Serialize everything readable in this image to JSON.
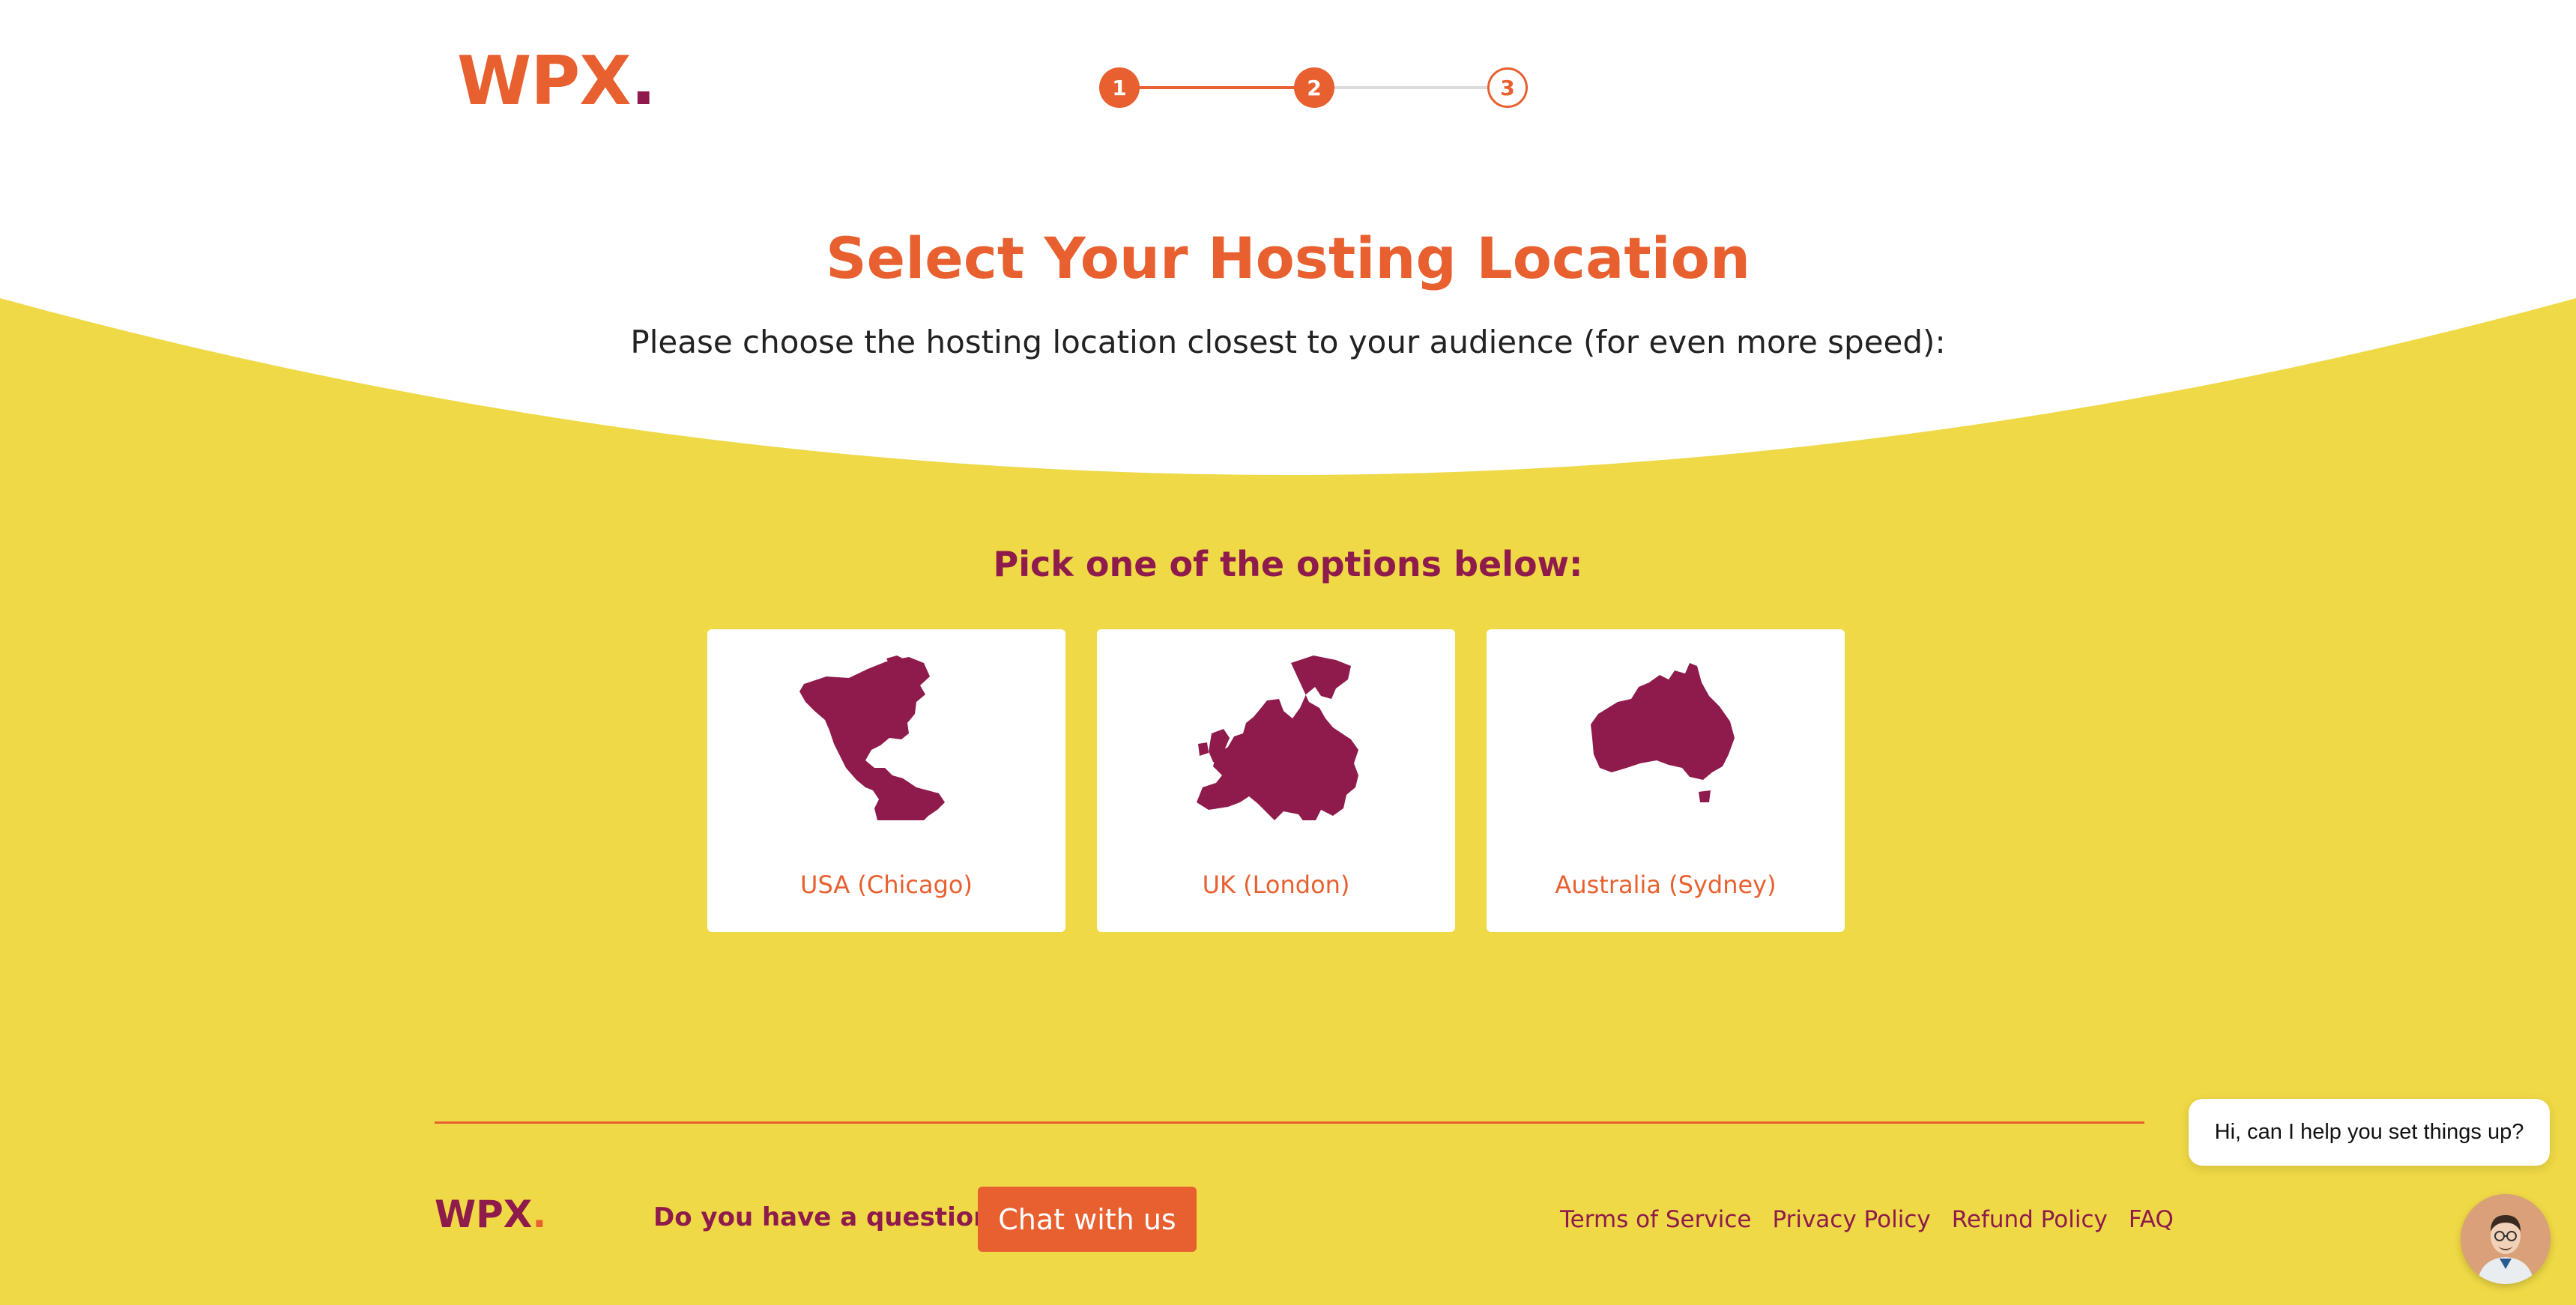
{
  "header": {
    "logo_text": "WPX",
    "logo_dot": ".",
    "steps": [
      "1",
      "2",
      "3"
    ],
    "current_step": 2
  },
  "main": {
    "title": "Select Your Hosting Location",
    "subtitle": "Please choose the hosting location closest to your audience (for even more speed):",
    "pick_label": "Pick one of the options below:",
    "locations": [
      {
        "label": "USA (Chicago)",
        "icon": "americas-map-icon"
      },
      {
        "label": "UK (London)",
        "icon": "europe-map-icon"
      },
      {
        "label": "Australia (Sydney)",
        "icon": "australia-map-icon"
      }
    ]
  },
  "footer": {
    "logo_text": "WPX",
    "logo_dot": ".",
    "question": "Do you have a question?",
    "chat_button": "Chat with us",
    "links": [
      "Terms of Service",
      "Privacy Policy",
      "Refund Policy",
      "FAQ"
    ]
  },
  "chat_widget": {
    "bubble_text": "Hi, can I help you set things up?",
    "avatar_icon": "support-agent-avatar"
  },
  "colors": {
    "brand_orange": "#e8602f",
    "brand_maroon": "#8e1b4b",
    "background_yellow": "#efd946",
    "card_white": "#ffffff"
  }
}
